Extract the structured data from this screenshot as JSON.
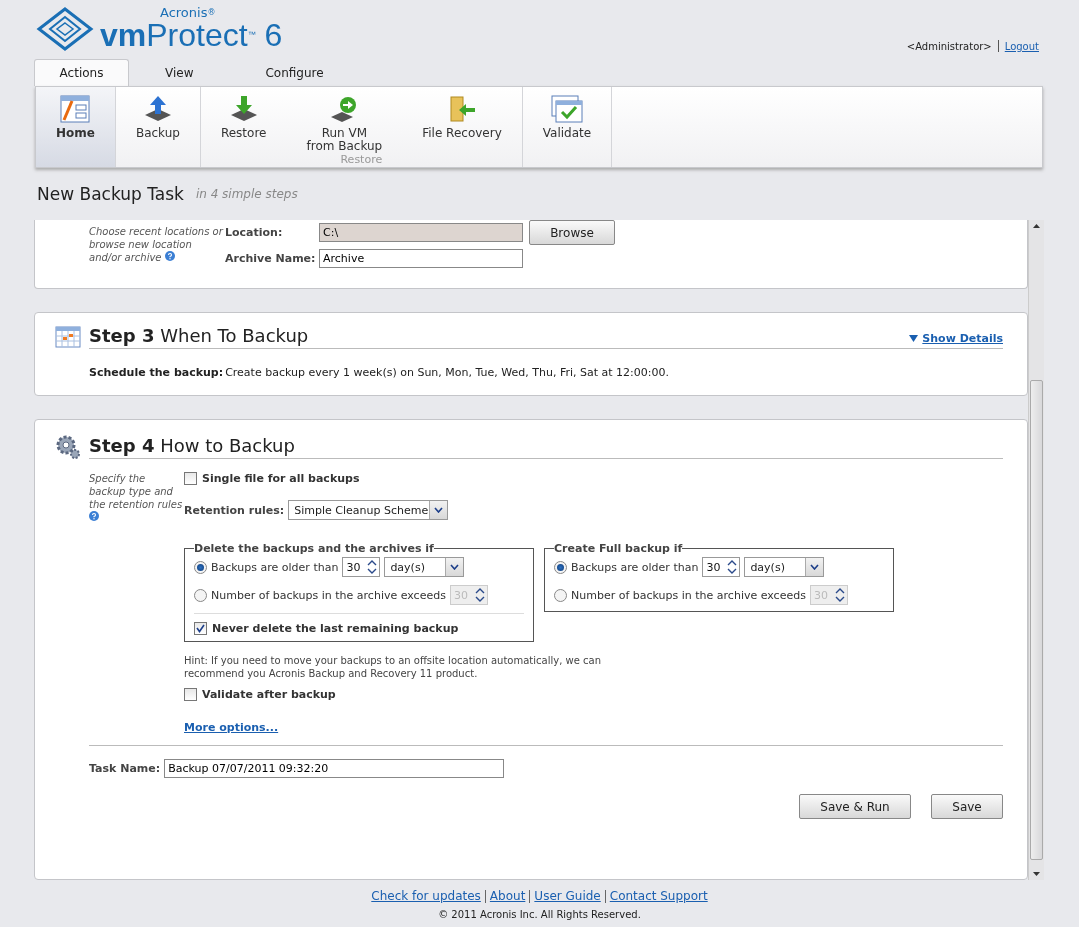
{
  "header": {
    "brand": "Acronis",
    "brand_mark": "®",
    "product_bold": "vm",
    "product": "Protect",
    "product_mark": "™",
    "version": "6",
    "user": "<Administrator>",
    "logout": "Logout"
  },
  "tabs": [
    {
      "label": "Actions",
      "selected": true
    },
    {
      "label": "View",
      "selected": false
    },
    {
      "label": "Configure",
      "selected": false
    }
  ],
  "ribbon": [
    {
      "items": [
        {
          "kind": "home",
          "label": "Home",
          "selected": true
        }
      ]
    },
    {
      "items": [
        {
          "kind": "backup",
          "label": "Backup",
          "selected": false
        }
      ]
    },
    {
      "label": "Restore",
      "items": [
        {
          "kind": "restore",
          "label": "Restore",
          "selected": false
        },
        {
          "kind": "run-vm",
          "label": "Run VM\nfrom Backup",
          "selected": false
        },
        {
          "kind": "file-recovery",
          "label": "File Recovery",
          "selected": false
        }
      ]
    },
    {
      "items": [
        {
          "kind": "validate",
          "label": "Validate",
          "selected": false
        }
      ]
    }
  ],
  "page": {
    "title": "New Backup Task",
    "subtitle": "in 4 simple steps"
  },
  "step2": {
    "hint": "Choose recent locations or browse new location and/or archive",
    "location_label": "Location:",
    "location": "C:\\",
    "browse": "Browse",
    "archive_label": "Archive Name:",
    "archive": "Archive"
  },
  "step3": {
    "number": "Step 3",
    "title": "When To Backup",
    "details": "Show Details",
    "schedule_label": "Schedule the backup:",
    "schedule": "Create backup every 1 week(s) on Sun, Mon, Tue, Wed, Thu, Fri, Sat at 12:00:00."
  },
  "step4": {
    "number": "Step 4",
    "title": "How to Backup",
    "hint": "Specify the backup type and the retention rules",
    "single_file": {
      "label": "Single file for all backups",
      "checked": false
    },
    "retention_label": "Retention rules:",
    "retention": "Simple Cleanup Scheme",
    "groups": [
      {
        "legend": "Delete the backups and the archives if",
        "options": [
          {
            "kind": "age",
            "label": "Backups are older than",
            "selected": true,
            "value": "30",
            "unit": "day(s)"
          },
          {
            "kind": "count",
            "label": "Number of backups in the archive exceeds",
            "selected": false,
            "value": "30"
          }
        ],
        "keep_last": {
          "label": "Never delete the last remaining backup",
          "checked": true
        }
      },
      {
        "legend": "Create Full backup if",
        "options": [
          {
            "kind": "age",
            "label": "Backups are older than",
            "selected": true,
            "value": "30",
            "unit": "day(s)"
          },
          {
            "kind": "count",
            "label": "Number of backups in the archive exceeds",
            "selected": false,
            "value": "30"
          }
        ]
      }
    ],
    "note": "Hint: If you need to move your backups to an offsite location automatically, we can recommend you Acronis Backup and Recovery 11 product.",
    "validate": {
      "label": "Validate after backup",
      "checked": false
    },
    "more": "More options...",
    "task_label": "Task Name:",
    "task": "Backup 07/07/2011 09:32:20",
    "buttons": [
      "Save & Run",
      "Save"
    ]
  },
  "footer": {
    "links": [
      "Check for updates",
      "About",
      "User Guide",
      "Contact Support"
    ],
    "copyright": "© 2011 Acronis Inc. All Rights Reserved."
  }
}
